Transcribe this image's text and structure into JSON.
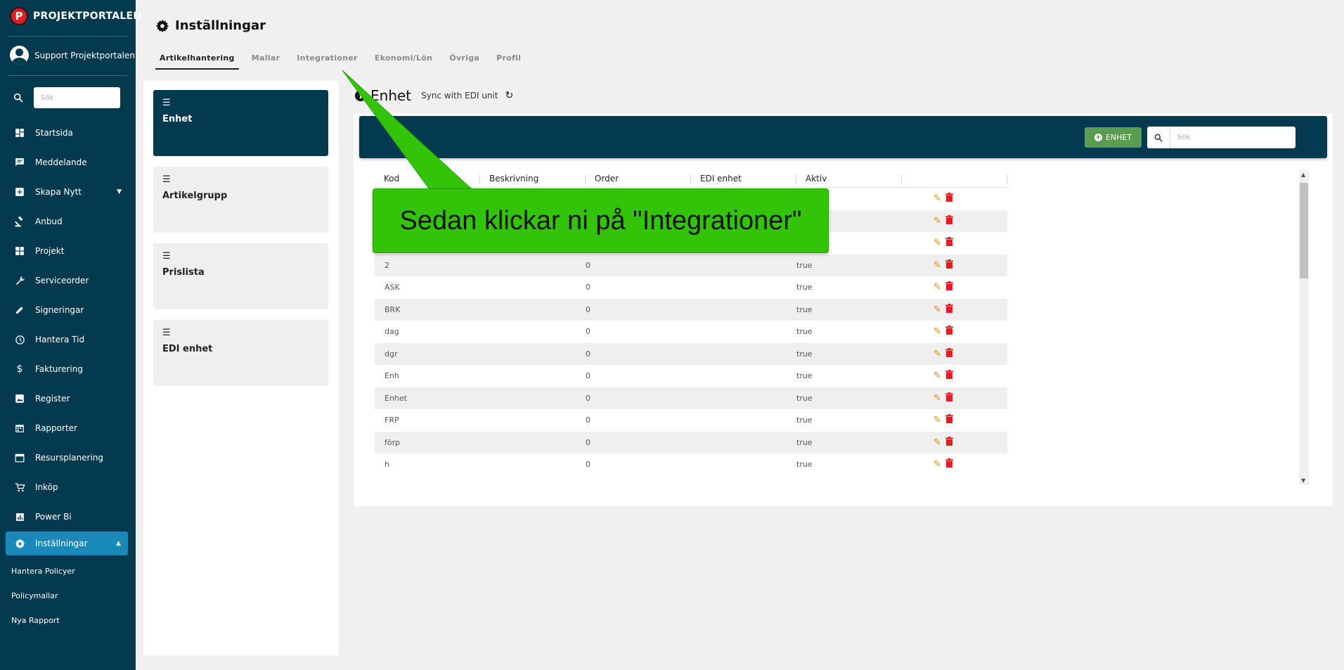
{
  "brand": {
    "logo": "P",
    "name": "PROJEKTPORTALEN"
  },
  "user": {
    "name": "Support Projektportalen"
  },
  "sidebar": {
    "search_placeholder": "Sök",
    "items": [
      {
        "label": "Startsida",
        "icon": "dashboard-icon"
      },
      {
        "label": "Meddelande",
        "icon": "message-icon"
      },
      {
        "label": "Skapa Nytt",
        "icon": "add-box-icon"
      },
      {
        "label": "Anbud",
        "icon": "gavel-icon"
      },
      {
        "label": "Projekt",
        "icon": "projects-icon"
      },
      {
        "label": "Serviceorder",
        "icon": "wrench-icon"
      },
      {
        "label": "Signeringar",
        "icon": "pencil-icon"
      },
      {
        "label": "Hantera Tid",
        "icon": "clock-icon"
      },
      {
        "label": "Fakturering",
        "icon": "dollar-icon"
      },
      {
        "label": "Register",
        "icon": "image-icon"
      },
      {
        "label": "Rapporter",
        "icon": "calendar-report-icon"
      },
      {
        "label": "Resursplanering",
        "icon": "calendar-icon"
      },
      {
        "label": "Inköp",
        "icon": "cart-icon"
      },
      {
        "label": "Power Bi",
        "icon": "chart-icon"
      }
    ],
    "active": {
      "label": "Inställningar",
      "icon": "gear-icon"
    },
    "subitems": [
      "Hantera Policyer",
      "Policymallar",
      "Nya Rapport"
    ]
  },
  "header": {
    "title": "Inställningar"
  },
  "tabs": [
    "Artikelhantering",
    "Mallar",
    "Integrationer",
    "Ekonomi/Lön",
    "Övriga",
    "Profil"
  ],
  "cards": [
    "Enhet",
    "Artikelgrupp",
    "Prislista",
    "EDI enhet"
  ],
  "section": {
    "title": "Enhet",
    "sync_text": "Sync with EDI unit"
  },
  "toolbar": {
    "add_label": "ENHET",
    "search_placeholder": "Sök"
  },
  "table": {
    "headers": [
      "Kod",
      "Beskrivning",
      "Order",
      "EDI enhet",
      "Aktiv"
    ],
    "rows": [
      {
        "kod": "",
        "order": "",
        "aktiv": ""
      },
      {
        "kod": "",
        "order": "",
        "aktiv": ""
      },
      {
        "kod": "",
        "order": "",
        "aktiv": ""
      },
      {
        "kod": "2",
        "order": "0",
        "aktiv": "true"
      },
      {
        "kod": "ASK",
        "order": "0",
        "aktiv": "true"
      },
      {
        "kod": "BRK",
        "order": "0",
        "aktiv": "true"
      },
      {
        "kod": "dag",
        "order": "0",
        "aktiv": "true"
      },
      {
        "kod": "dgr",
        "order": "0",
        "aktiv": "true"
      },
      {
        "kod": "Enh",
        "order": "0",
        "aktiv": "true"
      },
      {
        "kod": "Enhet",
        "order": "0",
        "aktiv": "true"
      },
      {
        "kod": "FRP",
        "order": "0",
        "aktiv": "true"
      },
      {
        "kod": "förp",
        "order": "0",
        "aktiv": "true"
      },
      {
        "kod": "h",
        "order": "0",
        "aktiv": "true"
      }
    ]
  },
  "callout": {
    "text": "Sedan klickar ni på \"Integrationer\"",
    "color": "#33c40a"
  },
  "colors": {
    "sidebar": "#033a4f",
    "active": "#1a88b8",
    "add_button": "#5a9c50",
    "edit": "#e08a00",
    "delete": "#e02020"
  }
}
